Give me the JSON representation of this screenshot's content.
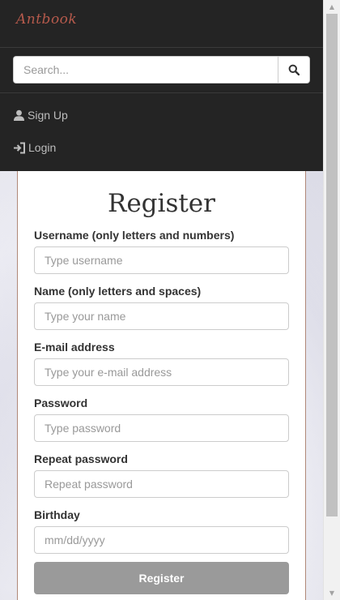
{
  "navbar": {
    "brand": "Antbook",
    "search": {
      "placeholder": "Search...",
      "value": ""
    },
    "links": [
      {
        "label": "Sign Up",
        "icon": "user-icon"
      },
      {
        "label": "Login",
        "icon": "login-icon"
      }
    ]
  },
  "form": {
    "title": "Register",
    "fields": [
      {
        "label": "Username (only letters and numbers)",
        "placeholder": "Type username",
        "value": ""
      },
      {
        "label": "Name (only letters and spaces)",
        "placeholder": "Type your name",
        "value": ""
      },
      {
        "label": "E-mail address",
        "placeholder": "Type your e-mail address",
        "value": ""
      },
      {
        "label": "Password",
        "placeholder": "Type password",
        "value": ""
      },
      {
        "label": "Repeat password",
        "placeholder": "Repeat password",
        "value": ""
      },
      {
        "label": "Birthday",
        "placeholder": "mm/dd/yyyy",
        "value": ""
      }
    ],
    "submit_label": "Register"
  },
  "colors": {
    "navbar_bg": "#242424",
    "brand": "#b65a4c",
    "nav_text": "#bdbdbd",
    "button_bg": "#9a9a9a"
  }
}
